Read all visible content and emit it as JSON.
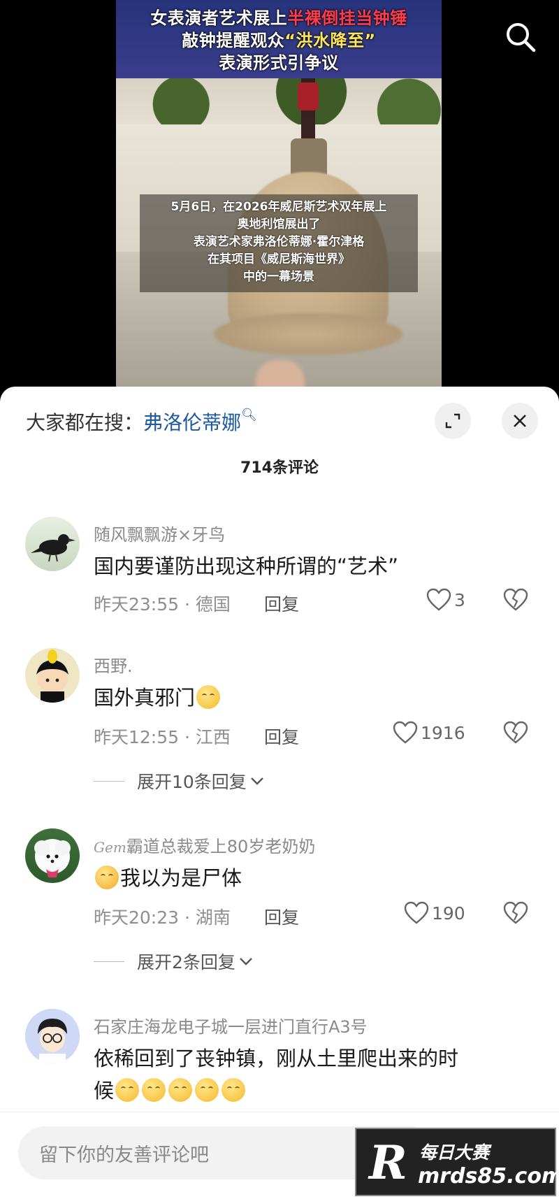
{
  "video": {
    "headline": {
      "line1_a": "女表演者艺术展上",
      "line1_b": "半裸倒挂当钟锤",
      "line2_a": "敲钟提醒观众",
      "line2_b": "“洪水降至”",
      "line3": "表演形式引争议"
    },
    "caption": [
      "5月6日，在2026年威尼斯艺术双年展上",
      "奥地利馆展出了",
      "表演艺术家弗洛伦蒂娜·霍尔津格",
      "在其项目《威尼斯海世界》",
      "中的一幕场景"
    ]
  },
  "sheet": {
    "search_prompt": "大家都在搜：",
    "search_term": "弗洛伦蒂娜",
    "comment_count": "714条评论"
  },
  "comments": [
    {
      "username": "随风飘飘游×牙鸟",
      "text": "国内要谨防出现这种所谓的“艺术”",
      "meta": "昨天23:55 · 德国",
      "reply": "回复",
      "likes": "3"
    },
    {
      "username": "西野.",
      "text": "国外真邪门",
      "meta": "昨天12:55 · 江西",
      "reply": "回复",
      "likes": "1916",
      "expand": "展开10条回复"
    },
    {
      "username": "霸道总裁爱上80岁老奶奶",
      "username_prefix": "Gem",
      "text": "我以为是尸体",
      "meta": "昨天20:23 · 湖南",
      "reply": "回复",
      "likes": "190",
      "expand": "展开2条回复"
    },
    {
      "username": "石家庄海龙电子城一层进门直行A3号",
      "text_line1": "依稀回到了丧钟镇，刚从土里爬出来的时",
      "text_line2": "候"
    }
  ],
  "input": {
    "placeholder": "留下你的友善评论吧"
  },
  "watermark": {
    "logo": "R",
    "title": "每日大赛",
    "url": "mrds85.com"
  },
  "colors": {
    "accent_link": "#1f5a9e",
    "headline_red": "#ff3b4e",
    "headline_yellow": "#ffe65a"
  }
}
